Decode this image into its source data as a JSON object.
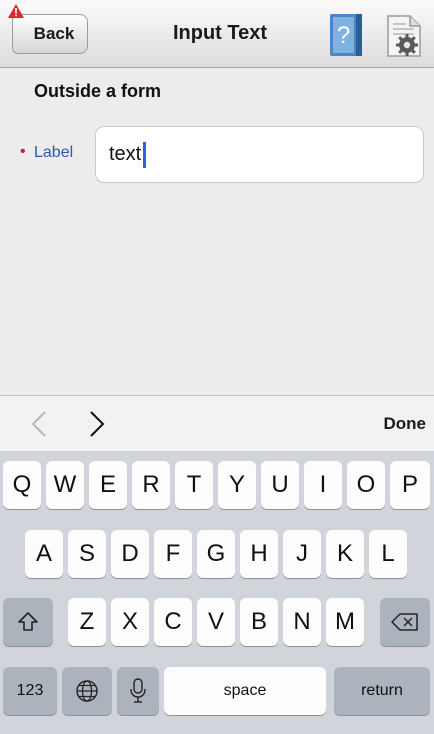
{
  "navbar": {
    "back_label": "Back",
    "title": "Input Text",
    "help_icon": "help-book-icon",
    "settings_icon": "settings-doc-icon",
    "warning_icon": "warning-triangle-icon",
    "warning_color": "#d92b2b"
  },
  "content": {
    "section_title": "Outside a form",
    "required_marker": "•",
    "field_label": "Label",
    "field_value": "text",
    "label_color": "#2f5aa8",
    "required_color": "#cc2222"
  },
  "accessory": {
    "prev_icon": "chevron-left-icon",
    "next_icon": "chevron-right-icon",
    "done_label": "Done"
  },
  "keyboard": {
    "row1": [
      "Q",
      "W",
      "E",
      "R",
      "T",
      "Y",
      "U",
      "I",
      "O",
      "P"
    ],
    "row2": [
      "A",
      "S",
      "D",
      "F",
      "G",
      "H",
      "J",
      "K",
      "L"
    ],
    "row3": [
      "Z",
      "X",
      "C",
      "V",
      "B",
      "N",
      "M"
    ],
    "shift_icon": "shift-icon",
    "delete_icon": "backspace-icon",
    "numbers_label": "123",
    "globe_icon": "globe-icon",
    "mic_icon": "microphone-icon",
    "space_label": "space",
    "return_label": "return"
  }
}
